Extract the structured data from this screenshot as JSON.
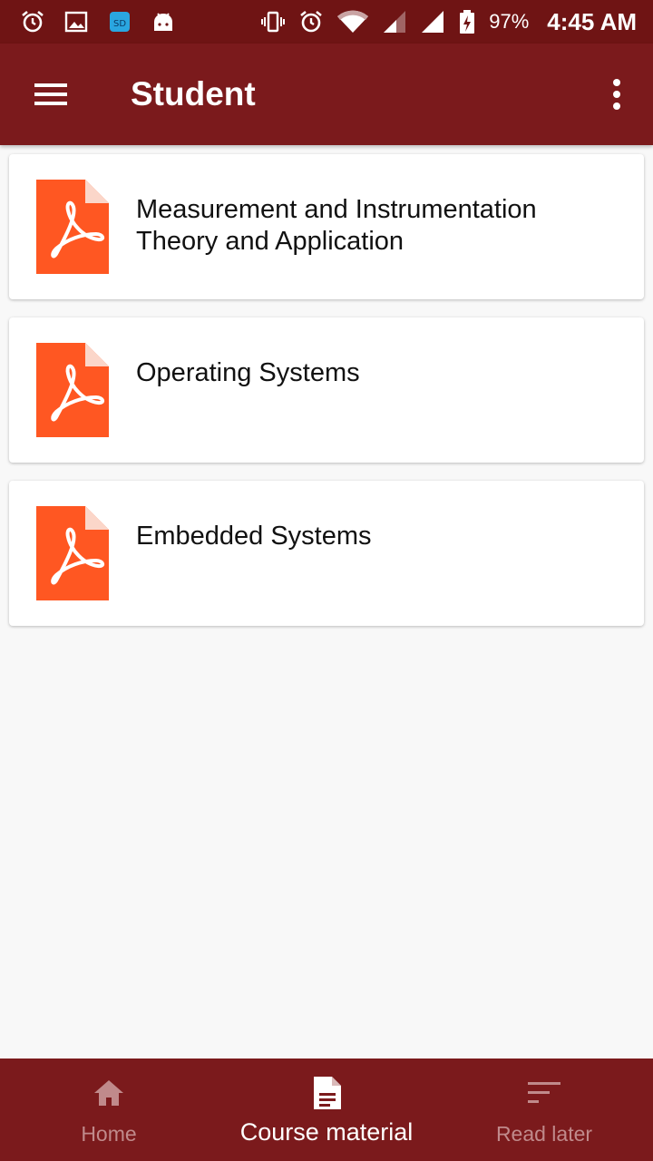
{
  "status_bar": {
    "left_icons": [
      "alarm-icon",
      "image-icon",
      "sd-card-icon",
      "android-icon"
    ],
    "right_icons": [
      "vibrate-icon",
      "alarm-icon",
      "wifi-icon",
      "signal-icon",
      "signal-icon",
      "battery-charging-icon"
    ],
    "sd_text": "SD",
    "battery": "97%",
    "time": "4:45 AM"
  },
  "app_bar": {
    "title": "Student",
    "menu_icon": "menu-icon",
    "more_icon": "more-vert-icon"
  },
  "documents": [
    {
      "title": "Measurement and Instrumentation Theory and Application",
      "icon": "pdf-icon"
    },
    {
      "title": "Operating Systems",
      "icon": "pdf-icon"
    },
    {
      "title": "Embedded Systems",
      "icon": "pdf-icon"
    }
  ],
  "bottom_nav": {
    "items": [
      {
        "label": "Home",
        "icon": "home-icon",
        "active": false
      },
      {
        "label": "Course material",
        "icon": "document-icon",
        "active": true
      },
      {
        "label": "Read later",
        "icon": "sort-icon",
        "active": false
      }
    ]
  },
  "colors": {
    "status_bar": "#6f1414",
    "primary": "#7b1a1c",
    "pdf_orange": "#ff5722",
    "background": "#f8f8f8"
  }
}
